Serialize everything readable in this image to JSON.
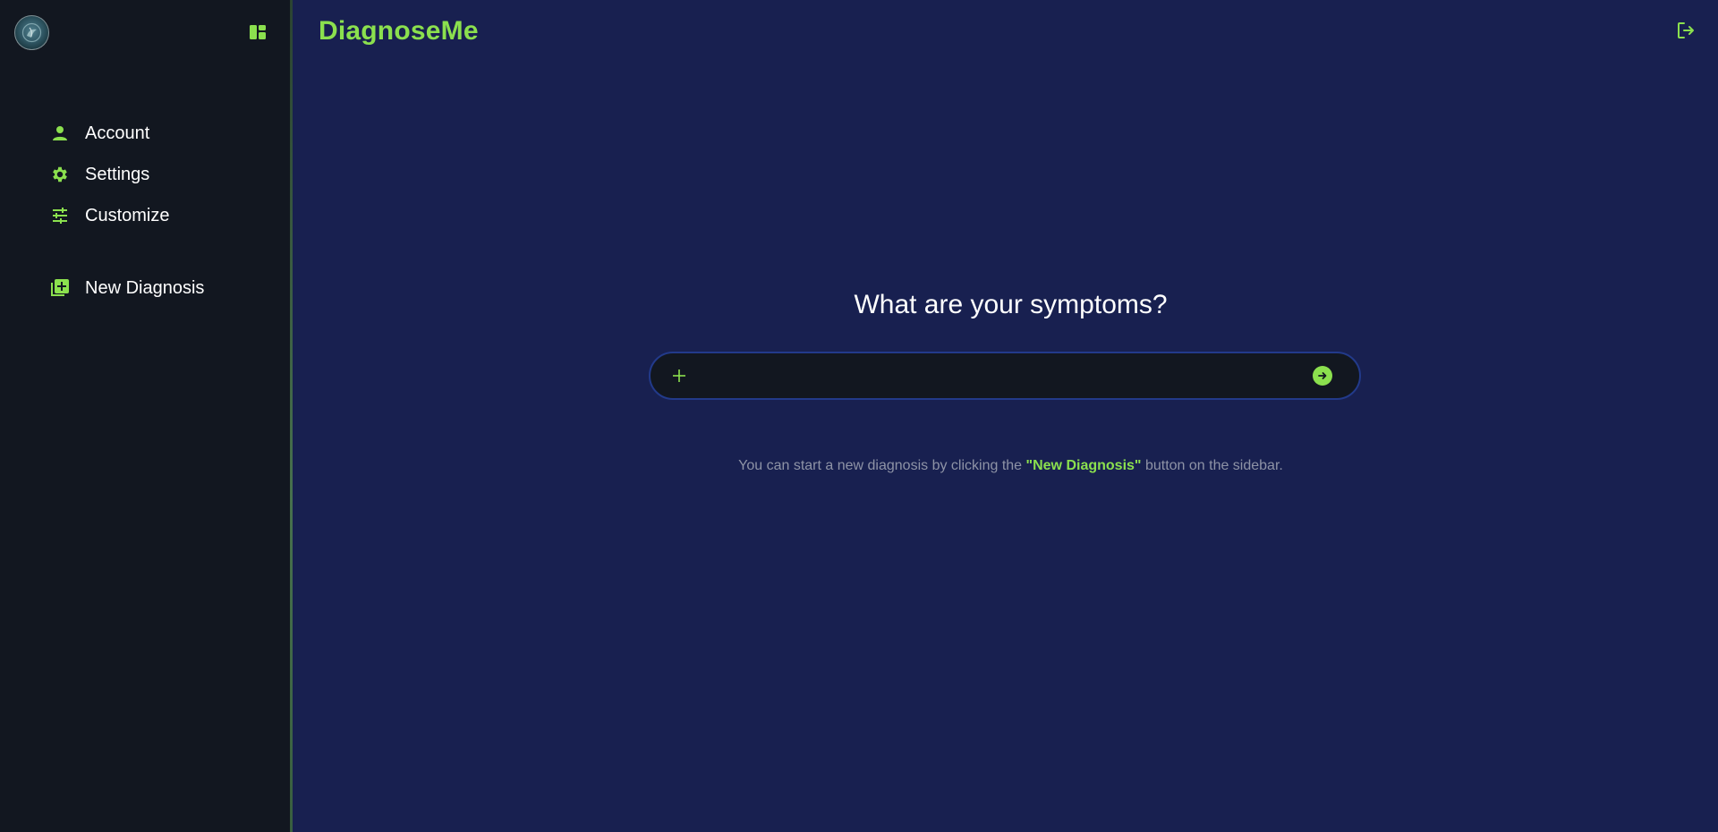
{
  "app": {
    "name": "DiagnoseMe",
    "accent_color": "#8be04e",
    "sidebar_bg": "#121720",
    "main_bg": "#182050"
  },
  "sidebar": {
    "avatar_icon": "user-avatar",
    "toggle_icon": "layout-panel-icon",
    "items": [
      {
        "label": "Account",
        "icon": "person-icon"
      },
      {
        "label": "Settings",
        "icon": "gear-icon"
      },
      {
        "label": "Customize",
        "icon": "sliders-icon"
      }
    ],
    "new_diagnosis": {
      "label": "New Diagnosis",
      "icon": "add-library-icon"
    }
  },
  "header": {
    "logout_icon": "logout-icon"
  },
  "main": {
    "question": "What are your symptoms?",
    "input": {
      "value": "",
      "placeholder": "",
      "attach_icon": "plus-icon",
      "send_icon": "arrow-right-circle-icon"
    },
    "hint": {
      "before": "You can start a new diagnosis by clicking the ",
      "highlight": "\"New Diagnosis\"",
      "after": " button on the sidebar."
    }
  }
}
